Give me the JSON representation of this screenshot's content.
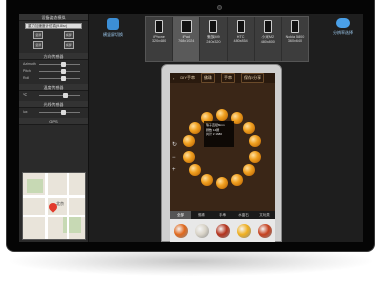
{
  "left_panel": {
    "header_device_tilt": "设备姿态模拟",
    "gravity_select": "重力加速度计仿真(9.8/s²)",
    "orientation_buttons": [
      "竖屏",
      "横屏",
      "竖屏",
      "横屏"
    ],
    "header_orientation": "方向传感器",
    "sliders_orientation": [
      {
        "label": "Azimuth",
        "level": 0.5
      },
      {
        "label": "Pitch",
        "level": 0.5
      },
      {
        "label": "Roll",
        "level": 0.5
      }
    ],
    "header_temperature": "温度传感器",
    "slider_temperature": {
      "label": "℃",
      "level": 0.55
    },
    "header_light": "光线传感器",
    "slider_light": {
      "label": "lux",
      "level": 0.5
    },
    "header_gps": "GPS",
    "map_label": "北京"
  },
  "toolbar": {
    "left_button_label": "横竖屏切换",
    "right_button_label": "分辨率选择",
    "devices": [
      {
        "name": "iPhone",
        "res": "320x480",
        "active": false
      },
      {
        "name": "iPad",
        "res": "768x1024",
        "active": true
      },
      {
        "name": "魅族M9",
        "res": "240x320",
        "active": false
      },
      {
        "name": "HTC",
        "res": "480x854",
        "active": false
      },
      {
        "name": "小米M2",
        "res": "480x800",
        "active": false
      },
      {
        "name": "Nokia 5800",
        "res": "360x640",
        "active": false
      }
    ]
  },
  "app": {
    "nav_title": "DIY手串",
    "nav_tabs": [
      "佛珠",
      "手串",
      "保存/分享"
    ],
    "tooltip_lines": [
      "珠子直径8mm",
      "颗数 14颗",
      "共计 ¥ 1680"
    ],
    "bottom_tabs": [
      "全部",
      "佛珠",
      "手串",
      "水晶石",
      "文玩类"
    ],
    "tray_colors": [
      "#e0681c",
      "#d9d4c8",
      "#b4321c",
      "#f0b020",
      "#c6401e"
    ]
  },
  "colors": {
    "screen_bg": "#1e1e1e",
    "panel_bg": "#2a2a2a",
    "accent": "#3c8fd6",
    "bead": "#f0a020"
  }
}
